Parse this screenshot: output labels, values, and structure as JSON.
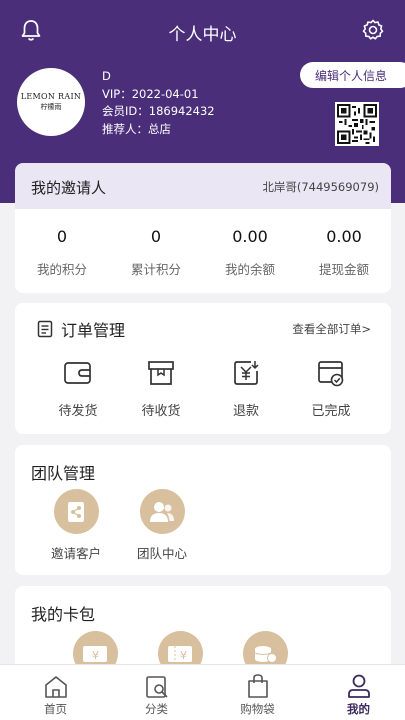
{
  "header": {
    "title": "个人中心"
  },
  "profile": {
    "logo_text": "LEMON RAIN",
    "logo_text_cn": "柠檬雨",
    "name": "D",
    "vip": "VIP：2022-04-01",
    "member_id": "会员ID：186942432",
    "referrer": "推荐人：总店",
    "edit_label": "编辑个人信息"
  },
  "invite": {
    "label": "我的邀请人",
    "value": "北岸哥(7449569079)"
  },
  "stats": [
    {
      "value": "0",
      "label": "我的积分"
    },
    {
      "value": "0",
      "label": "累计积分"
    },
    {
      "value": "0.00",
      "label": "我的余额"
    },
    {
      "value": "0.00",
      "label": "提现金额"
    }
  ],
  "orders": {
    "title": "订单管理",
    "more": "查看全部订单>",
    "items": [
      {
        "label": "待发货",
        "icon": "wallet-icon"
      },
      {
        "label": "待收货",
        "icon": "box-icon"
      },
      {
        "label": "退款",
        "icon": "refund-icon"
      },
      {
        "label": "已完成",
        "icon": "completed-icon"
      }
    ]
  },
  "team": {
    "title": "团队管理",
    "items": [
      {
        "label": "邀请客户",
        "icon": "share-icon"
      },
      {
        "label": "团队中心",
        "icon": "team-icon"
      }
    ]
  },
  "wallet": {
    "title": "我的卡包"
  },
  "tabbar": [
    {
      "label": "首页",
      "icon": "home-icon"
    },
    {
      "label": "分类",
      "icon": "category-icon"
    },
    {
      "label": "购物袋",
      "icon": "bag-icon"
    },
    {
      "label": "我的",
      "icon": "user-icon",
      "active": true
    }
  ],
  "colors": {
    "primary": "#4b2e7a",
    "gold": "#d8c09e",
    "background": "#f2f2f4"
  }
}
